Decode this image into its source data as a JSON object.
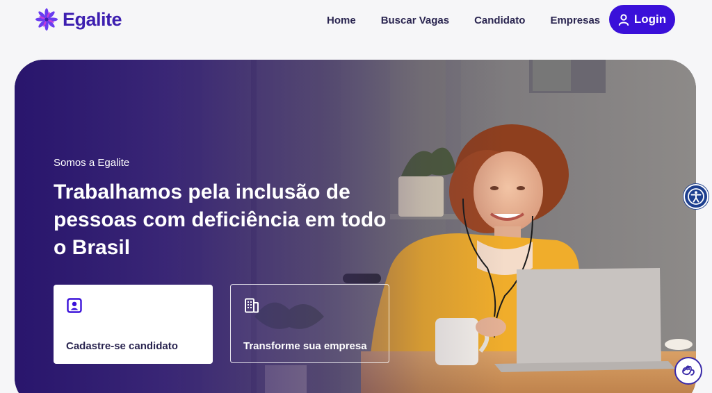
{
  "brand": {
    "name": "Egalite",
    "color": "#3d1fb0"
  },
  "nav": {
    "items": [
      {
        "label": "Home"
      },
      {
        "label": "Buscar Vagas"
      },
      {
        "label": "Candidato"
      },
      {
        "label": "Empresas"
      }
    ],
    "login_label": "Login",
    "login_color": "#3a10d9"
  },
  "hero": {
    "eyebrow": "Somos a Egalite",
    "headline": "Trabalhamos pela inclusão de pessoas com deficiência em todo o Brasil",
    "cards": [
      {
        "label": "Cadastre-se candidato",
        "icon": "user-badge-icon"
      },
      {
        "label": "Transforme sua empresa",
        "icon": "building-icon"
      }
    ]
  },
  "widgets": {
    "accessibility_icon": "accessibility-icon",
    "libras_icon": "sign-language-icon"
  }
}
